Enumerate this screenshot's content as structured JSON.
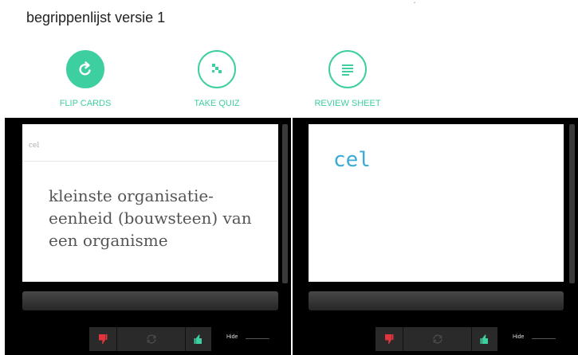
{
  "page": {
    "title": "begrippenlijst versie 1",
    "stray_mark": "´"
  },
  "modes": [
    {
      "label": "FLIP CARDS",
      "icon": "refresh-icon",
      "active": true
    },
    {
      "label": "TAKE QUIZ",
      "icon": "quiz-icon",
      "active": false
    },
    {
      "label": "REVIEW SHEET",
      "icon": "list-icon",
      "active": false
    }
  ],
  "cards": [
    {
      "side": "definition",
      "term": "cel",
      "definition": "kleinste organisatie-eenheid (bouwsteen) van een organisme"
    },
    {
      "side": "term",
      "term": "cel"
    }
  ],
  "controls": {
    "hide_label": "Hide",
    "dislike_icon": "thumbs-down-icon",
    "flip_icon": "flip-icon",
    "like_icon": "thumbs-up-icon"
  },
  "colors": {
    "accent": "#3ecfa1",
    "term_blue": "#3aabd9",
    "dislike_red": "#e0343f",
    "like_teal": "#3ecfa1"
  }
}
